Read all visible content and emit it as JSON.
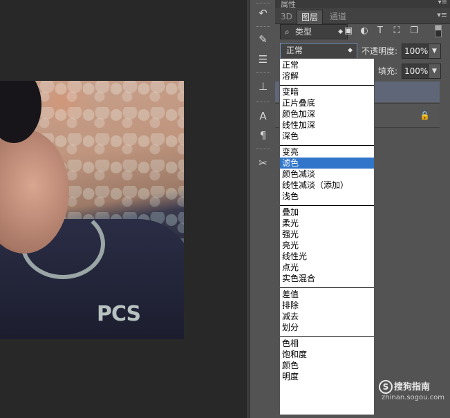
{
  "panel": {
    "title": "属性",
    "tabs": [
      "3D",
      "图层",
      "通道"
    ],
    "filter": {
      "label": "类型"
    },
    "blend_mode": "正常",
    "opacity": {
      "label": "不透明度:",
      "value": "100%"
    },
    "fill": {
      "label": "填充:",
      "value": "100%"
    }
  },
  "dropdown": {
    "groups": [
      [
        "正常",
        "溶解"
      ],
      [
        "变暗",
        "正片叠底",
        "颜色加深",
        "线性加深",
        "深色"
      ],
      [
        "变亮",
        "滤色",
        "颜色减淡",
        "线性减淡（添加）",
        "浅色"
      ],
      [
        "叠加",
        "柔光",
        "强光",
        "亮光",
        "线性光",
        "点光",
        "实色混合"
      ],
      [
        "差值",
        "排除",
        "减去",
        "划分"
      ],
      [
        "色相",
        "饱和度",
        "颜色",
        "明度"
      ]
    ],
    "selected": "滤色"
  },
  "watermark": {
    "brand": "搜狗指南",
    "url": "zhinan.sogou.com"
  },
  "photo": {
    "shirt_text": "PCS"
  },
  "icons": {
    "toolbar": [
      "history-icon",
      "brush-presets-icon",
      "adjust-icon",
      "clone-source-icon",
      "character-icon",
      "paragraph-icon",
      "tools-icon"
    ],
    "filter": [
      "image-filter-icon",
      "adjustment-filter-icon",
      "type-filter-icon",
      "shape-filter-icon",
      "smart-object-filter-icon"
    ]
  },
  "colors": {
    "selection": "#3075c9",
    "panel_bg": "#535353",
    "canvas_bg": "#282828"
  }
}
